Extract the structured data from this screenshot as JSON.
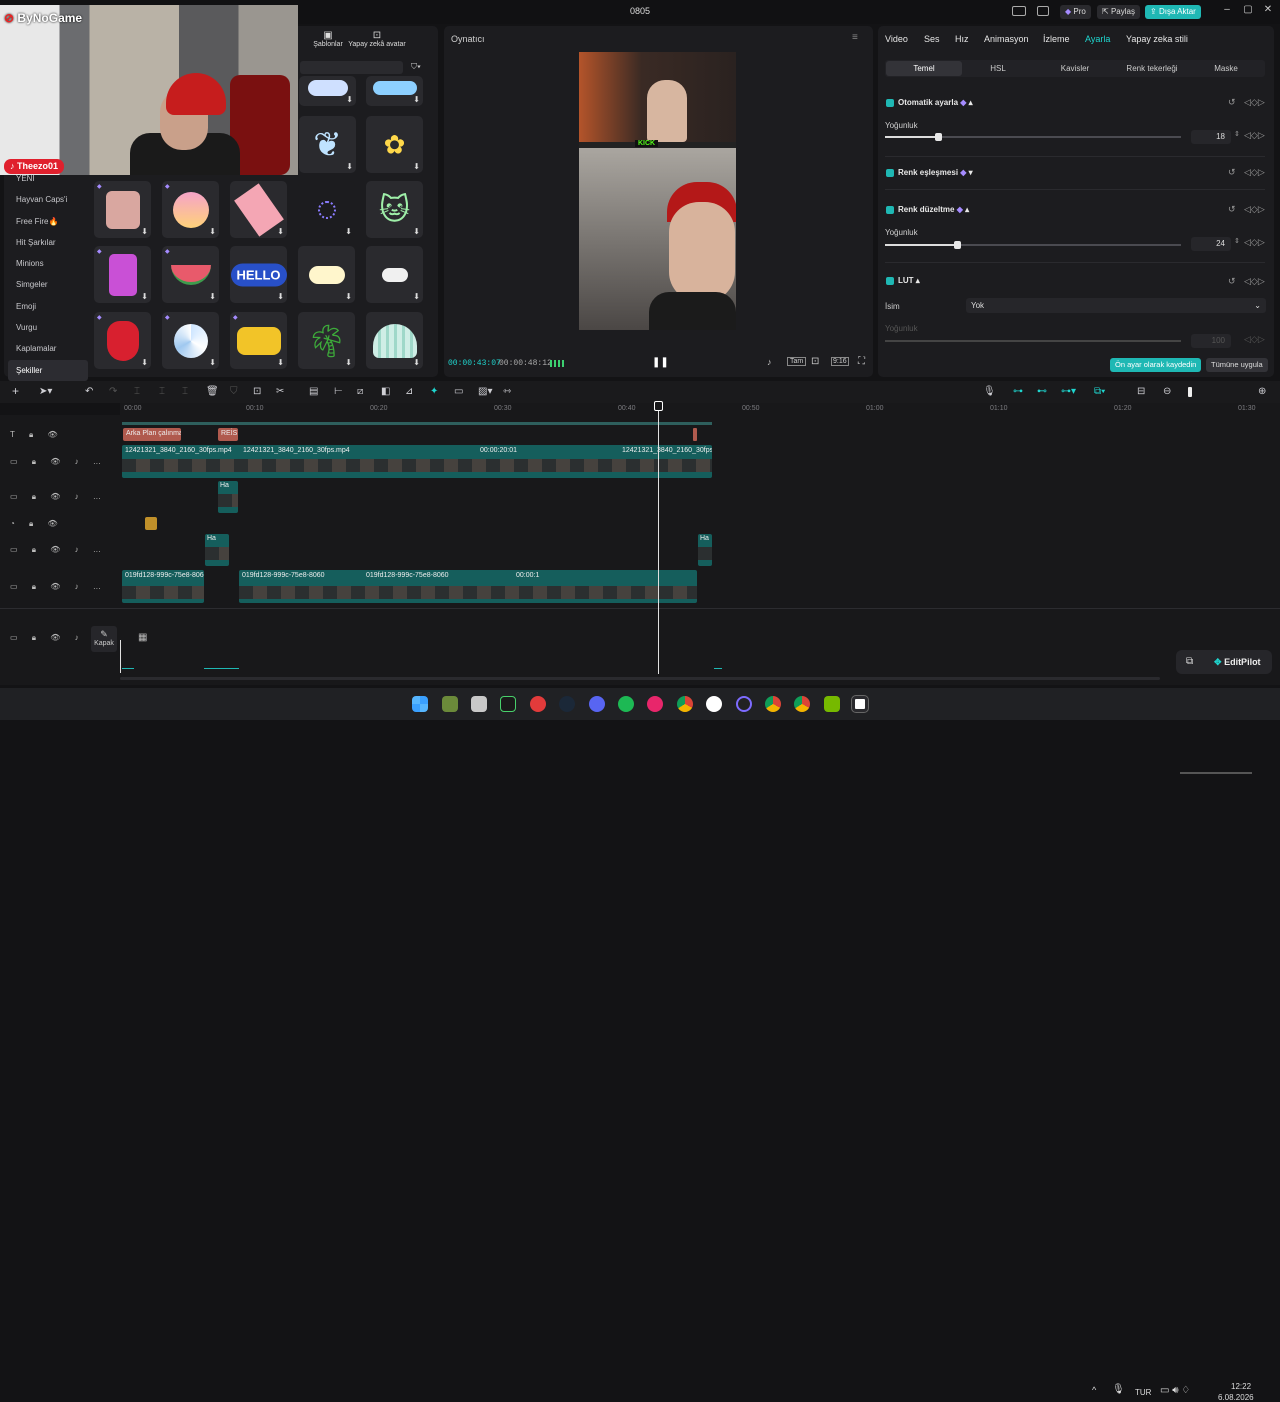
{
  "titlebar": {
    "title": "0805",
    "pro": "Pro",
    "share": "Paylaş",
    "export": "Dışa Aktar"
  },
  "webcam": {
    "logo": "ByNoGame",
    "tiktok_name": "Theezo01"
  },
  "asset_tabs": {
    "templates": "Şablonlar",
    "ai_avatar": "Yapay zekâ avatar"
  },
  "sticker_categories": [
    "YENİ",
    "Hayvan Caps'i",
    "Free Fire🔥",
    "Hit Şarkılar",
    "Minions",
    "Simgeler",
    "Emoji",
    "Vurgu",
    "Kaplamalar",
    "Şekiller"
  ],
  "sticker_selected_index": 9,
  "stickers": [
    {
      "name": "clouds-blue-sticker"
    },
    {
      "name": "cloud-sticker"
    },
    {
      "name": "butterfly-sticker"
    },
    {
      "name": "flower-sticker"
    },
    {
      "name": "basket-sticker"
    },
    {
      "name": "palm-sunset-sticker"
    },
    {
      "name": "towel-sticker"
    },
    {
      "name": "neon-ring-sticker"
    },
    {
      "name": "neon-cat-sticker"
    },
    {
      "name": "suitcase-sticker"
    },
    {
      "name": "watermelon-sticker"
    },
    {
      "name": "hello-sticker",
      "text": "HELLO"
    },
    {
      "name": "cloud-yellow-sticker"
    },
    {
      "name": "cloud-small-sticker"
    },
    {
      "name": "strawberry-sticker"
    },
    {
      "name": "beach-ball-sticker"
    },
    {
      "name": "summer-sticker"
    },
    {
      "name": "palm-tree-sticker"
    },
    {
      "name": "shell-sticker"
    }
  ],
  "player": {
    "title": "Oynatıcı",
    "current_time": "00:00:43:07",
    "total_time": "00:00:48:12",
    "video_label": "KICK"
  },
  "inspector": {
    "tabs": [
      "Video",
      "Ses",
      "Hız",
      "Animasyon",
      "İzleme",
      "Ayarla",
      "Yapay zeka stili"
    ],
    "active_tab": "Ayarla",
    "subtabs": [
      "Temel",
      "HSL",
      "Kavisler",
      "Renk tekerleği",
      "Maske"
    ],
    "active_subtab": "Temel",
    "auto_adjust": {
      "title": "Otomatik ayarla",
      "label": "Yoğunluk",
      "value": "18",
      "level": 0.18
    },
    "color_match": {
      "title": "Renk eşleşmesi"
    },
    "color_correct": {
      "title": "Renk düzeltme",
      "label": "Yoğunluk",
      "value": "24",
      "level": 0.24
    },
    "lut": {
      "title": "LUT",
      "name_label": "İsim",
      "name_value": "Yok",
      "intensity_label": "Yoğunluk",
      "intensity_value": "100"
    },
    "save_preset": "Ön ayar olarak kaydedin",
    "apply_all": "Tümüne uygula"
  },
  "timeline": {
    "ruler": [
      "00:00",
      "00:10",
      "00:20",
      "00:30",
      "00:40",
      "00:50",
      "01:00",
      "01:10",
      "01:20",
      "01:30"
    ],
    "text_clips": [
      "Arka Plan çalınma",
      "REİS"
    ],
    "main_clip_label": "12421321_3840_2160_30fps.mp4",
    "main_clip_time": "00:00:20:01",
    "short_clip_label": "Ha",
    "bottom_clip_label": "019fd128-999c-75e8-8060",
    "bottom_clip_time": "00:00:1",
    "cover_label": "Kapak"
  },
  "editpilot": "EditPilot",
  "taskbar": {
    "lang": "TUR",
    "time": "12:22",
    "date": "6.08.2026"
  }
}
